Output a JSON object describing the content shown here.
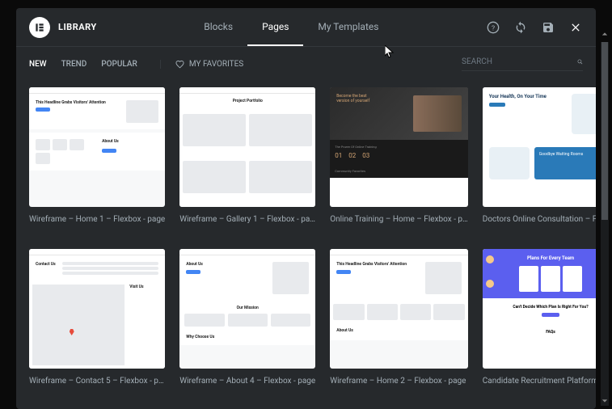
{
  "header": {
    "title": "LIBRARY",
    "tabs": [
      {
        "label": "Blocks",
        "active": false
      },
      {
        "label": "Pages",
        "active": true
      },
      {
        "label": "My Templates",
        "active": false
      }
    ]
  },
  "filters": {
    "items": [
      {
        "label": "NEW",
        "active": true
      },
      {
        "label": "TREND",
        "active": false
      },
      {
        "label": "POPULAR",
        "active": false
      }
    ],
    "favorites_label": "MY FAVORITES"
  },
  "search": {
    "placeholder": "SEARCH"
  },
  "templates": [
    {
      "title": "Wireframe – Home 1 – Flexbox - page",
      "type": "wf-home1"
    },
    {
      "title": "Wireframe – Gallery 1 – Flexbox - pa…",
      "type": "wf-gallery"
    },
    {
      "title": "Online Training – Home – Flexbox - p…",
      "type": "training"
    },
    {
      "title": "Doctors Online Consultation – Flexb…",
      "type": "doctors"
    },
    {
      "title": "Wireframe – Contact 5 – Flexbox - p…",
      "type": "wf-contact"
    },
    {
      "title": "Wireframe – About 4 – Flexbox - page",
      "type": "wf-about"
    },
    {
      "title": "Wireframe – Home 2 – Flexbox - page",
      "type": "wf-home2"
    },
    {
      "title": "Candidate Recruitment Platform - pa…",
      "type": "recruit"
    }
  ],
  "thumbs": {
    "home1_headline": "This Headline Grabs Visitors' Attention",
    "home1_about": "About Us",
    "gallery_title": "Project Portfolio",
    "training_headline": "Become the best version of yourself",
    "training_sub": "The Power Of Online Training",
    "training_fav": "Community Favorites",
    "doctors_title": "Your Health, On Your Time",
    "doctors_goodbye": "Goodbye Waiting Rooms",
    "contact_title": "Contact Us",
    "contact_visit": "Visit Us",
    "about_title": "About Us",
    "about_mission": "Our Mission",
    "about_why": "Why Choose Us",
    "home2_headline": "This Headline Grabs Visitors' Attention",
    "home2_about": "About Us",
    "recruit_title": "Plans For Every Team",
    "recruit_sub": "Can't Decide Which Plan Is Right For You?",
    "recruit_faq": "FAQs"
  }
}
